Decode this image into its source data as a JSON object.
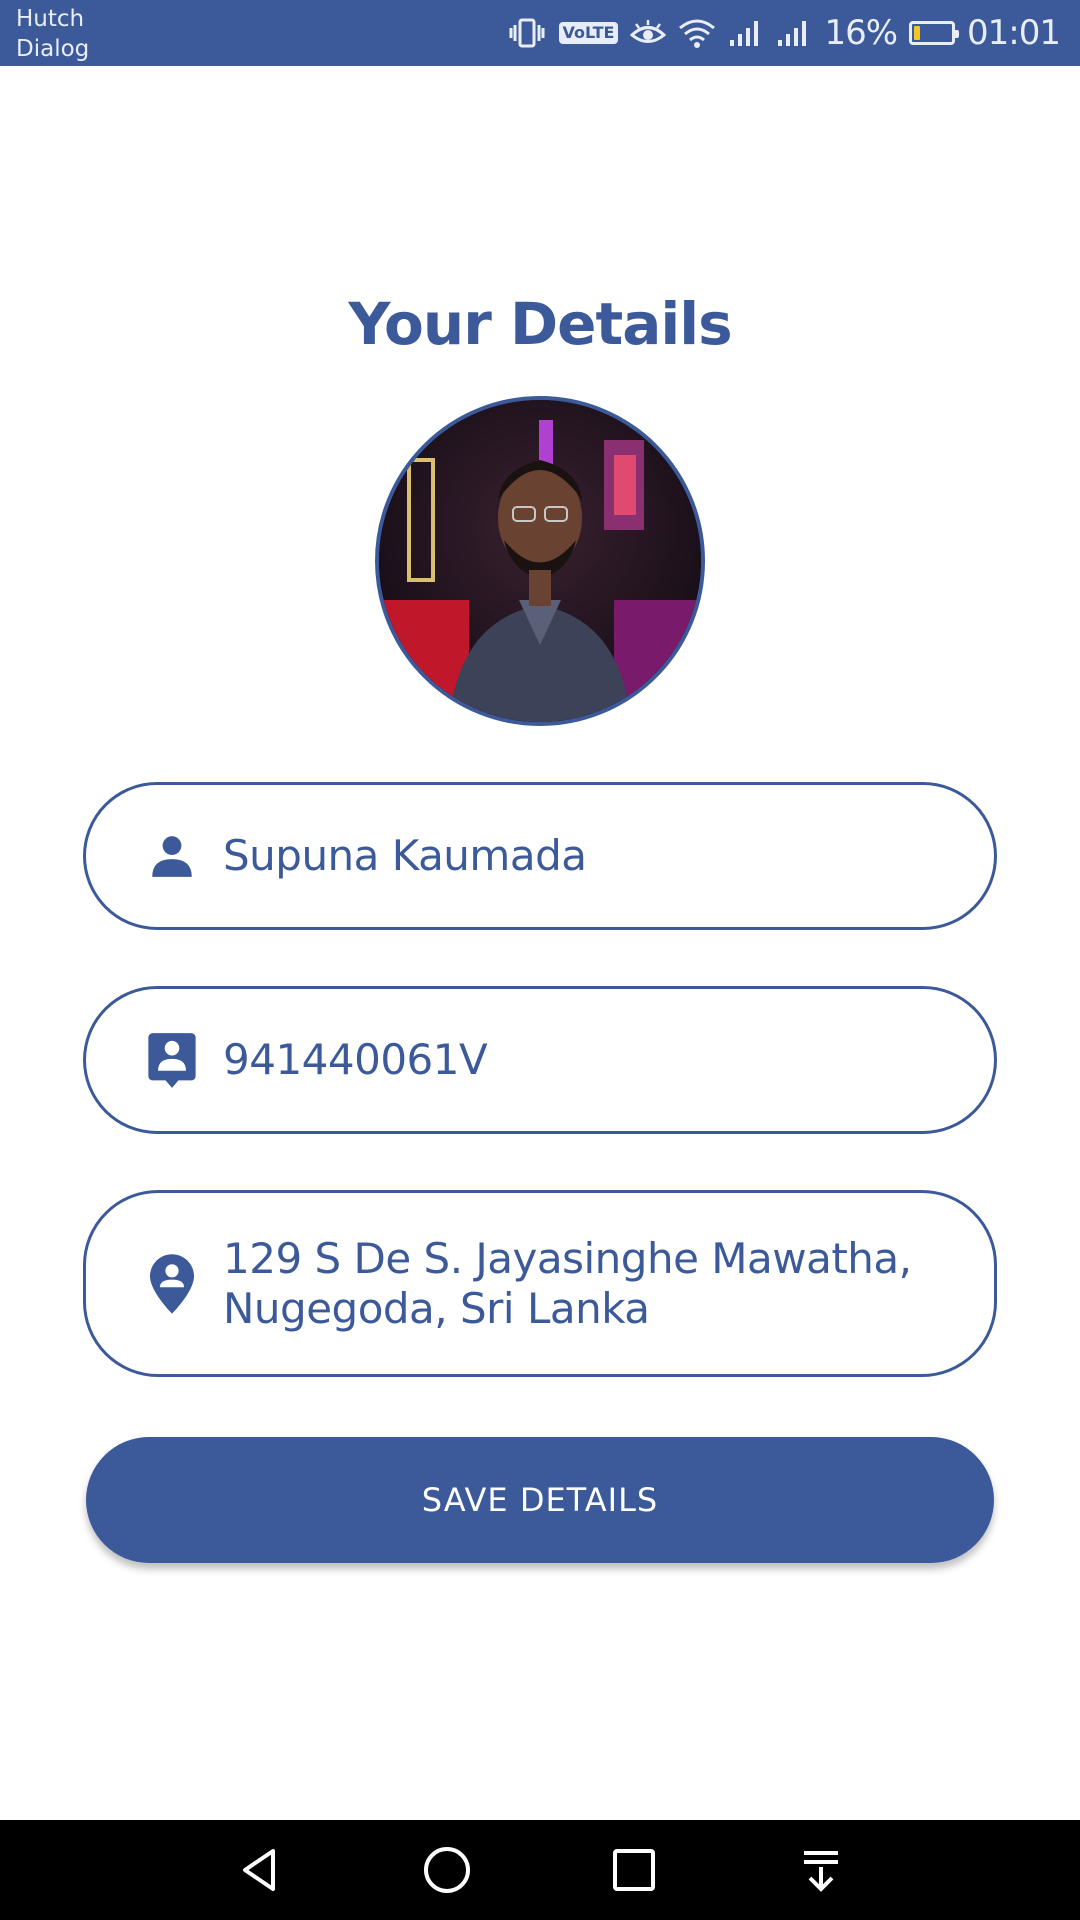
{
  "status_bar": {
    "carrier_1": "Hutch",
    "carrier_2": "Dialog",
    "volte_label": "VoLTE",
    "battery_percent": "16%",
    "battery_level": 0.16,
    "time": "01:01",
    "icons": [
      "vibrate-icon",
      "volte-icon",
      "eye-comfort-icon",
      "wifi-icon",
      "signal-icon",
      "signal-icon",
      "battery-icon"
    ]
  },
  "main": {
    "title": "Your Details",
    "avatar_icon": "profile-photo",
    "fields": [
      {
        "icon": "person-icon",
        "value": "Supuna Kaumada"
      },
      {
        "icon": "contact-card-icon",
        "value": "941440061V"
      },
      {
        "icon": "location-pin-icon",
        "value_line_1": "129 S De S. Jayasinghe Mawatha,",
        "value_line_2": "Nugegoda, Sri Lanka"
      }
    ],
    "save_button_label": "SAVE DETAILS"
  },
  "nav_bar": {
    "icons": [
      "back-icon",
      "home-icon",
      "recents-icon",
      "notification-pull-icon"
    ]
  },
  "colors": {
    "accent": "#3c5a9a",
    "background": "#ffffff",
    "navbar": "#000000",
    "battery_low": "#f3c623"
  }
}
